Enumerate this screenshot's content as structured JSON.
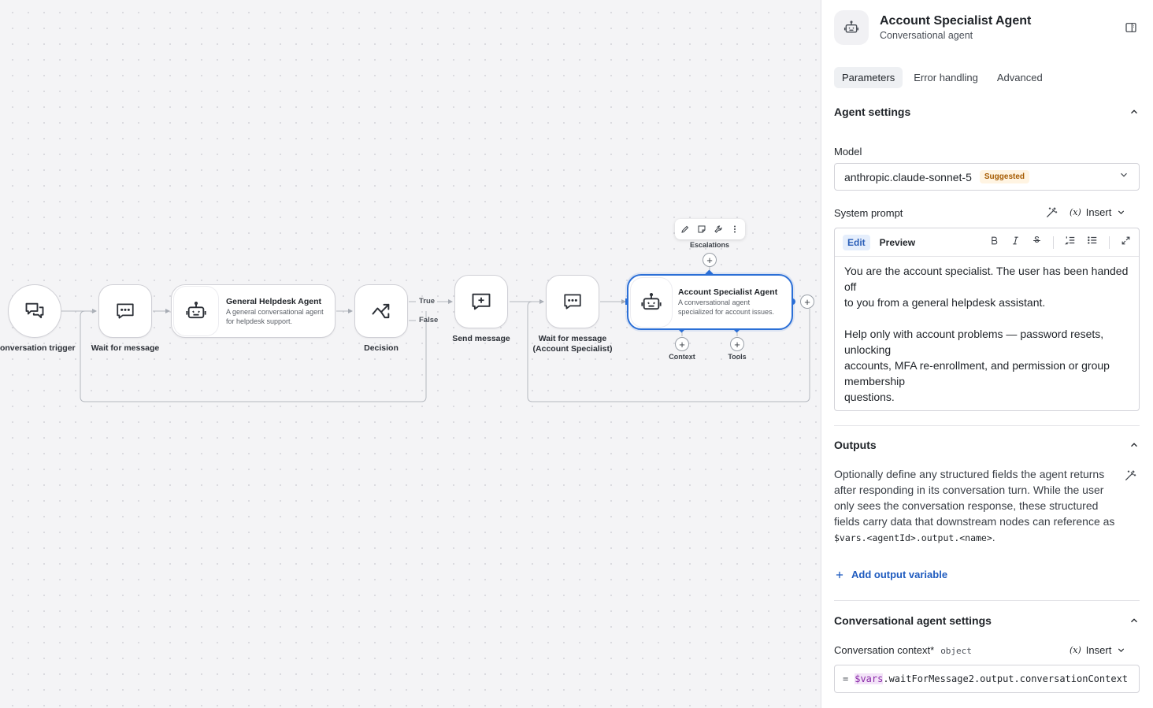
{
  "canvas": {
    "nodes": {
      "trigger": {
        "label": "Conversation trigger"
      },
      "wait1": {
        "label": "Wait for message"
      },
      "general_agent": {
        "title": "General Helpdesk Agent",
        "desc": "A general conversational agent for helpdesk support."
      },
      "decision": {
        "label": "Decision"
      },
      "send": {
        "label": "Send message"
      },
      "wait2": {
        "label": "Wait for message (Account Specialist)"
      },
      "specialist": {
        "title": "Account Specialist Agent",
        "desc": "A conversational agent specialized for account issues."
      }
    },
    "edge_labels": {
      "true": "True",
      "false": "False"
    },
    "ports": {
      "escalations": "Escalations",
      "context": "Context",
      "tools": "Tools"
    },
    "plus": "+"
  },
  "panel": {
    "title": "Account Specialist Agent",
    "subtitle": "Conversational agent",
    "tabs": [
      "Parameters",
      "Error handling",
      "Advanced"
    ],
    "agent_settings": {
      "heading": "Agent settings",
      "model_label": "Model",
      "model_value": "anthropic.claude-sonnet-5",
      "model_badge": "Suggested",
      "system_prompt_label": "System prompt",
      "insert_label": "Insert",
      "editor_tabs": [
        "Edit",
        "Preview"
      ],
      "prompt_lines": [
        "You are the account specialist. The user has been handed off",
        "to you from a general helpdesk assistant.",
        "",
        "Help only with account problems — password resets, unlocking",
        "accounts, MFA re-enrollment, and permission or group membership",
        "questions."
      ]
    },
    "outputs": {
      "heading": "Outputs",
      "text": "Optionally define any structured fields the agent returns after responding in its conversation turn. While the user only sees the conversation response, these structured fields carry data that downstream nodes can reference as",
      "code": "$vars.<agentId>.output.<name>",
      "period": ".",
      "add_label": "Add output variable"
    },
    "conv_settings": {
      "heading": "Conversational agent settings",
      "context_label": "Conversation context",
      "required": "*",
      "context_type": "object",
      "insert_label": "Insert",
      "expr_eq": "=",
      "expr_var": "$vars",
      "expr_rest": ".waitForMessage2.output.conversationContext"
    }
  }
}
